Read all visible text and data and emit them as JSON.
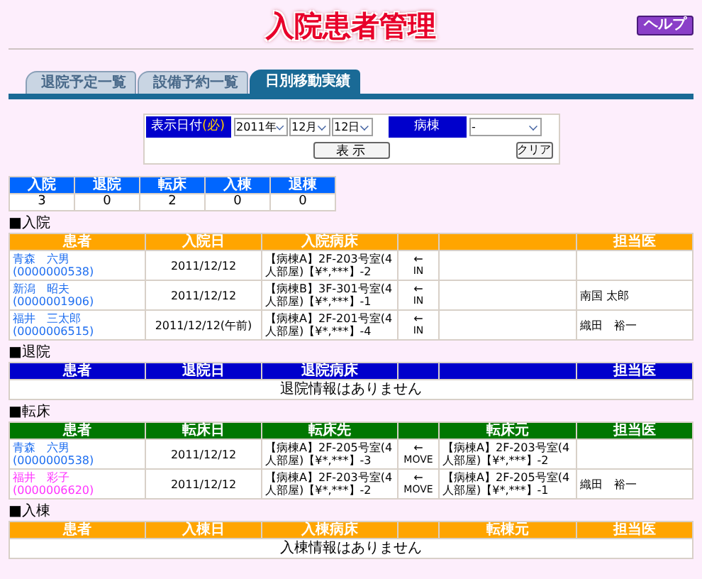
{
  "header": {
    "title": "入院患者管理",
    "help_button": "ヘルプ"
  },
  "tabs": [
    {
      "label": "退院予定一覧",
      "selected": false
    },
    {
      "label": "設備予約一覧",
      "selected": false
    },
    {
      "label": "日別移動実績",
      "selected": true
    }
  ],
  "filter": {
    "date_label": "表示日付",
    "required_mark": "(必)",
    "year": "2011年",
    "month": "12月",
    "day": "12日",
    "ward_label": "病棟",
    "ward": "-",
    "show_button": "表 示",
    "clear_button": "クリア"
  },
  "summary": [
    {
      "label": "入院",
      "count": "3"
    },
    {
      "label": "退院",
      "count": "0"
    },
    {
      "label": "転床",
      "count": "2"
    },
    {
      "label": "入棟",
      "count": "0"
    },
    {
      "label": "退棟",
      "count": "0"
    }
  ],
  "sections": [
    {
      "title": "■入院",
      "color": "#ffa500",
      "columns": {
        "patient": "患者",
        "date": "入院日",
        "bed": "入院病床",
        "doctor": "担当医"
      },
      "rows": [
        {
          "name": "青森　六男",
          "id": "(0000000538)",
          "color": "#1e6ef0",
          "date": "2011/12/12",
          "bed": "【病棟A】2F-203号室(4人部屋)【¥*,***】-2",
          "arrow": "←",
          "movement": "IN"
        },
        {
          "name": "新潟　昭夫",
          "id": "(0000001906)",
          "color": "#1e6ef0",
          "date": "2011/12/12",
          "bed": "【病棟B】3F-301号室(4人部屋)【¥*,***】-1",
          "arrow": "←",
          "movement": "IN",
          "doctor": "南国 太郎"
        },
        {
          "name": "福井　三太郎",
          "id": "(0000006515)",
          "color": "#1e6ef0",
          "date": "2011/12/12(午前)",
          "bed": "【病棟A】2F-201号室(4人部屋)【¥*,***】-4",
          "arrow": "←",
          "movement": "IN",
          "doctor": "織田　裕一"
        }
      ]
    },
    {
      "title": "■退院",
      "color": "#0000cc",
      "columns": {
        "patient": "患者",
        "date": "退院日",
        "bed": "退院病床",
        "doctor": "担当医"
      },
      "empty_message": "退院情報はありません"
    },
    {
      "title": "■転床",
      "color": "#007700",
      "columns": {
        "patient": "患者",
        "date": "転床日",
        "bed": "転床先",
        "source": "転床元",
        "doctor": "担当医"
      },
      "rows": [
        {
          "name": "青森　六男",
          "id": "(0000000538)",
          "color": "#1e6ef0",
          "date": "2011/12/12",
          "bed": "【病棟A】2F-205号室(4人部屋)【¥*,***】-3",
          "arrow": "←",
          "movement": "MOVE",
          "source": "【病棟A】2F-203号室(4人部屋)【¥*,***】-2"
        },
        {
          "name": "福井　彩子",
          "id": "(0000006620)",
          "color": "#ff33ff",
          "date": "2011/12/12",
          "bed": "【病棟A】2F-203号室(4人部屋)【¥*,***】-2",
          "arrow": "←",
          "movement": "MOVE",
          "source": "【病棟A】2F-205号室(4人部屋)【¥*,***】-1",
          "doctor": "織田　裕一"
        }
      ]
    },
    {
      "title": "■入棟",
      "color": "#ffa500",
      "columns": {
        "patient": "患者",
        "date": "入棟日",
        "bed": "入棟病床",
        "source": "転棟元",
        "doctor": "担当医"
      },
      "empty_message": "入棟情報はありません"
    }
  ]
}
